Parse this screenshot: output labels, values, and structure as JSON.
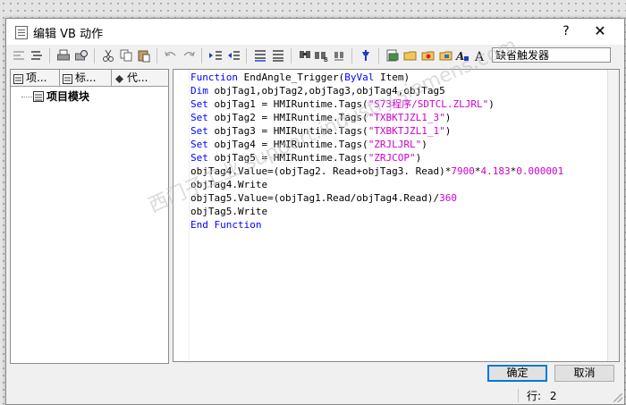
{
  "dialog": {
    "title": "编辑 VB 动作",
    "help_glyph": "?",
    "close_glyph": "✕"
  },
  "toolbar": {
    "font_name": "缺省触发器",
    "icons": [
      "indent-icon",
      "outdent-icon",
      "print-icon",
      "print-preview-icon",
      "cut-icon",
      "copy-icon",
      "paste-icon",
      "undo-icon",
      "redo-icon",
      "increase-indent-icon",
      "decrease-indent-icon",
      "comment-icon",
      "uncomment-icon",
      "find-icon",
      "replace-icon",
      "goto-icon",
      "compile-icon",
      "new-folder-icon",
      "open-folder-icon",
      "insert-object-icon",
      "bookmark-icon",
      "font-icon",
      "font-size-icon"
    ]
  },
  "tree": {
    "tabs": [
      {
        "label": "项..."
      },
      {
        "label": "标..."
      },
      {
        "label": "代..."
      }
    ],
    "items": [
      {
        "label": "项目模块"
      }
    ]
  },
  "code": {
    "lines": [
      [
        {
          "t": "Function ",
          "c": "kw"
        },
        {
          "t": "EndAngle_Trigger(",
          "c": "n"
        },
        {
          "t": "ByVal",
          "c": "kw"
        },
        {
          "t": " Item)",
          "c": "n"
        }
      ],
      [
        {
          "t": "Dim",
          "c": "kw"
        },
        {
          "t": " objTag1,objTag2,objTag3,objTag4,objTag5",
          "c": "n"
        }
      ],
      [
        {
          "t": "Set",
          "c": "kw"
        },
        {
          "t": " objTag1 = HMIRuntime.Tags(",
          "c": "n"
        },
        {
          "t": "\"S73程序/SDTCL.ZLJRL\"",
          "c": "s"
        },
        {
          "t": ")",
          "c": "n"
        }
      ],
      [
        {
          "t": "Set",
          "c": "kw"
        },
        {
          "t": " objTag2 = HMIRuntime.Tags(",
          "c": "n"
        },
        {
          "t": "\"TXBKTJZL1_3\"",
          "c": "s"
        },
        {
          "t": ")",
          "c": "n"
        }
      ],
      [
        {
          "t": "Set",
          "c": "kw"
        },
        {
          "t": " objTag3 = HMIRuntime.Tags(",
          "c": "n"
        },
        {
          "t": "\"TXBKTJZL1_1\"",
          "c": "s"
        },
        {
          "t": ")",
          "c": "n"
        }
      ],
      [
        {
          "t": "Set",
          "c": "kw"
        },
        {
          "t": " objTag4 = HMIRuntime.Tags(",
          "c": "n"
        },
        {
          "t": "\"ZRJLJRL\"",
          "c": "s"
        },
        {
          "t": ")",
          "c": "n"
        }
      ],
      [
        {
          "t": "Set",
          "c": "kw"
        },
        {
          "t": " objTag5 = HMIRuntime.Tags(",
          "c": "n"
        },
        {
          "t": "\"ZRJCOP\"",
          "c": "s"
        },
        {
          "t": ")",
          "c": "n"
        }
      ],
      [
        {
          "t": "objTag4.Value=(objTag2. Read+objTag3. Read)*",
          "c": "n"
        },
        {
          "t": "7900",
          "c": "s"
        },
        {
          "t": "*",
          "c": "n"
        },
        {
          "t": "4.183",
          "c": "s"
        },
        {
          "t": "*",
          "c": "n"
        },
        {
          "t": "0.000001",
          "c": "s"
        }
      ],
      [
        {
          "t": "objTag4.Write",
          "c": "n"
        }
      ],
      [
        {
          "t": "objTag5.Value=(objTag1.Read/objTag4.Read)/",
          "c": "n"
        },
        {
          "t": "360",
          "c": "s"
        }
      ],
      [
        {
          "t": "objTag5.Write",
          "c": "n"
        }
      ],
      [
        {
          "t": "End Function",
          "c": "kw"
        }
      ]
    ]
  },
  "buttons": {
    "ok": "确定",
    "cancel": "取消"
  },
  "status": {
    "line_label": "行:",
    "line_value": "2"
  },
  "watermark": {
    "text": "西门子工业  support.industry.siemens.com"
  },
  "colors": {
    "keyword": "#0000ff",
    "string": "#cc00cc",
    "default_button_border": "#0078d7"
  }
}
